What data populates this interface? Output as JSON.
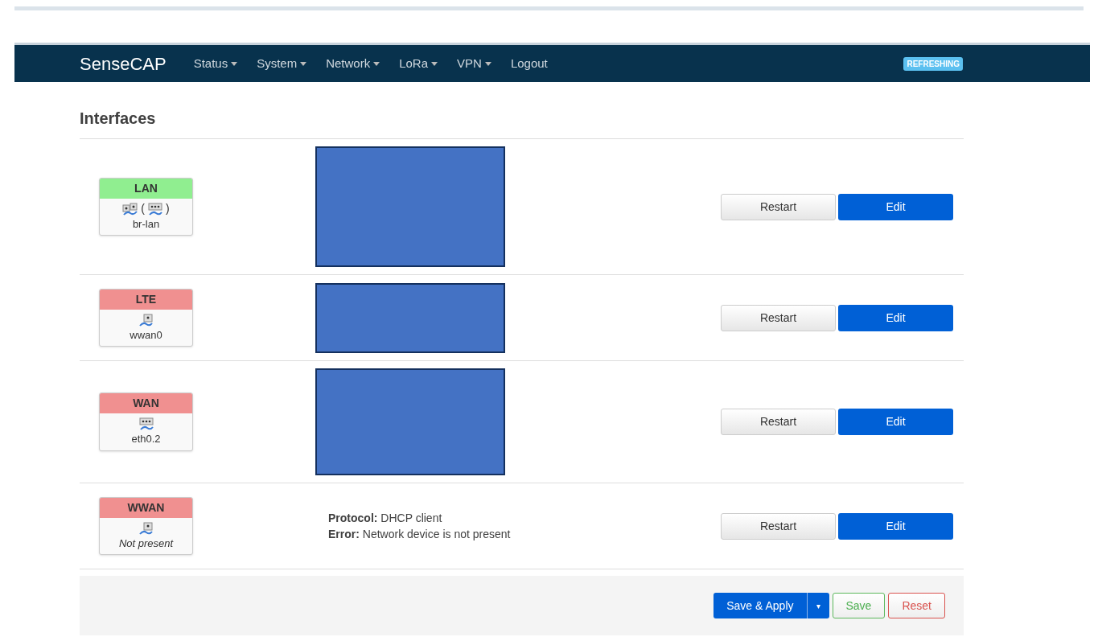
{
  "navbar": {
    "brand": "SenseCAP",
    "menus": [
      {
        "label": "Status",
        "dropdown": true
      },
      {
        "label": "System",
        "dropdown": true
      },
      {
        "label": "Network",
        "dropdown": true
      },
      {
        "label": "LoRa",
        "dropdown": true
      },
      {
        "label": "VPN",
        "dropdown": true
      },
      {
        "label": "Logout",
        "dropdown": false
      }
    ],
    "badge": "REFRESHING"
  },
  "title": "Interfaces",
  "interfaces": [
    {
      "name": "LAN",
      "color": "#90ee90",
      "devices": [
        {
          "kind": "bridge"
        },
        {
          "kind": "switch",
          "before": "(",
          "after": ")"
        }
      ],
      "device_label": "br-lan",
      "present": true,
      "details": {
        "kind": "redacted-tall"
      },
      "buttons": [
        "Restart",
        "Edit"
      ]
    },
    {
      "name": "LTE",
      "color": "#f09090",
      "devices": [
        {
          "kind": "port"
        }
      ],
      "device_label": "wwan0",
      "present": true,
      "details": {
        "kind": "redacted-short"
      },
      "buttons": [
        "Restart",
        "Edit"
      ]
    },
    {
      "name": "WAN",
      "color": "#f09090",
      "devices": [
        {
          "kind": "switch"
        }
      ],
      "device_label": "eth0.2",
      "present": true,
      "details": {
        "kind": "redacted-medium"
      },
      "buttons": [
        "Restart",
        "Edit"
      ]
    },
    {
      "name": "WWAN",
      "color": "#f09090",
      "devices": [
        {
          "kind": "port"
        }
      ],
      "device_label": "Not present",
      "present": false,
      "details": {
        "kind": "info",
        "lines": [
          {
            "label": "Protocol:",
            "value": "DHCP client"
          },
          {
            "label": "Error:",
            "value": "Network device is not present"
          }
        ]
      },
      "buttons": [
        "Restart",
        "Edit"
      ]
    }
  ],
  "footer": {
    "save_apply": "Save & Apply",
    "dropdown": "▾",
    "save": "Save",
    "reset": "Reset"
  }
}
